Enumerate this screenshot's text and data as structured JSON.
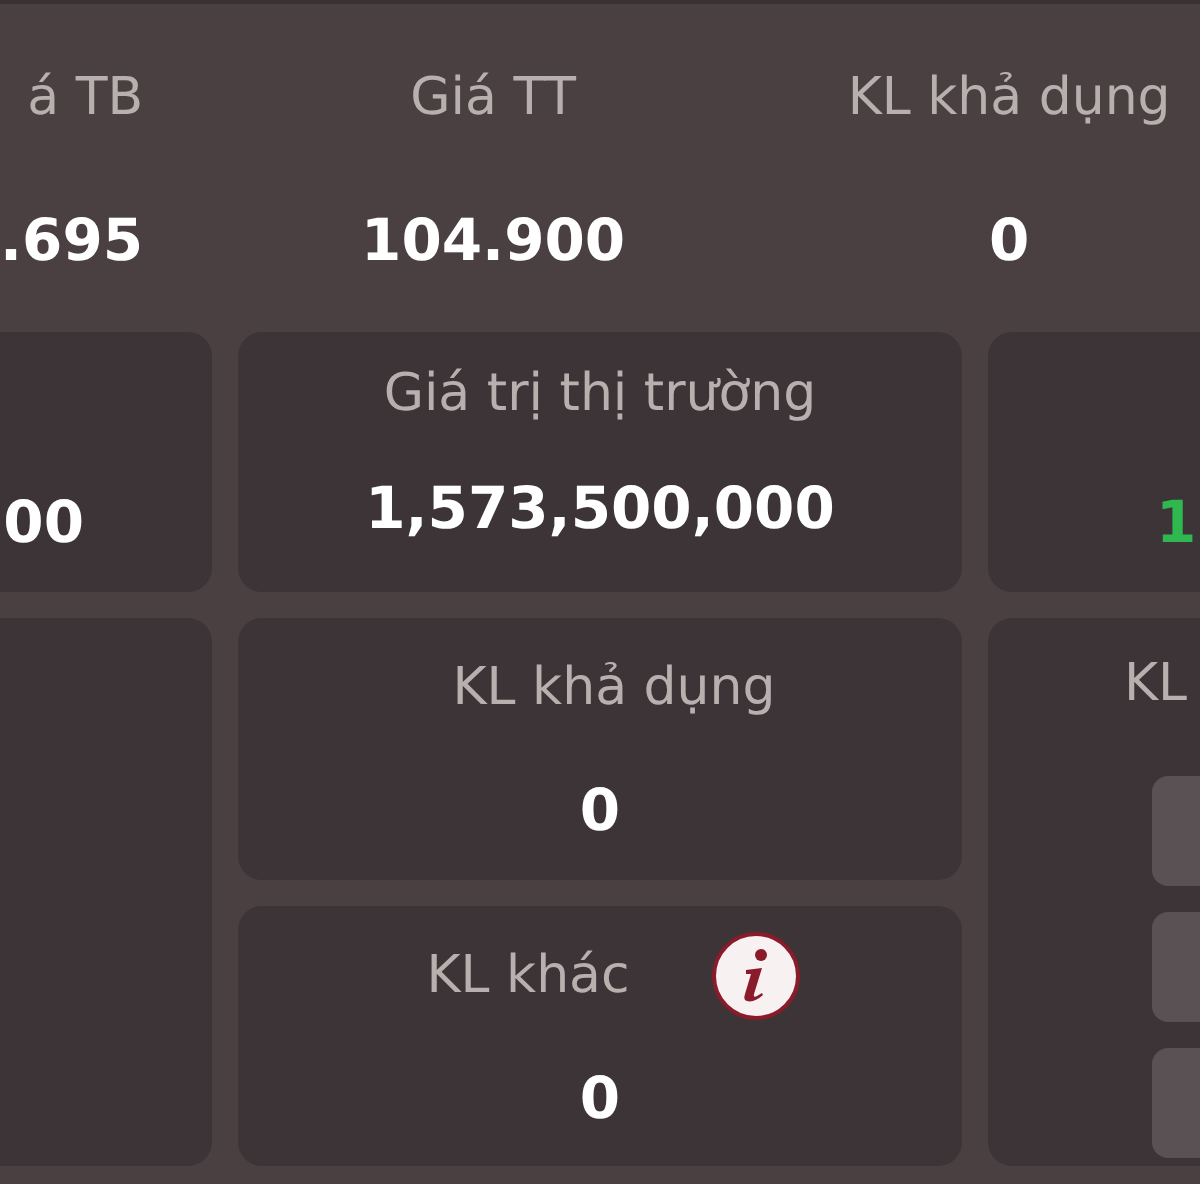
{
  "summary": [
    {
      "label": "á TB",
      "value": ".695"
    },
    {
      "label": "Giá TT",
      "value": "104.900"
    },
    {
      "label": "KL khả dụng",
      "value": "0"
    }
  ],
  "market_row": {
    "left_value": "00",
    "middle": {
      "label": "Giá trị thị trường",
      "value": "1,573,500,000"
    },
    "right_value": "1",
    "right_positive": true
  },
  "detail_cards": [
    {
      "label": "KL khả dụng",
      "value": "0",
      "info": false
    },
    {
      "label": "KL khác",
      "value": "0",
      "info": true
    }
  ],
  "right_panel": {
    "label": "KL",
    "buttons": [
      {
        "kind": "blank"
      },
      {
        "kind": "blank"
      },
      {
        "kind": "blank"
      }
    ]
  }
}
